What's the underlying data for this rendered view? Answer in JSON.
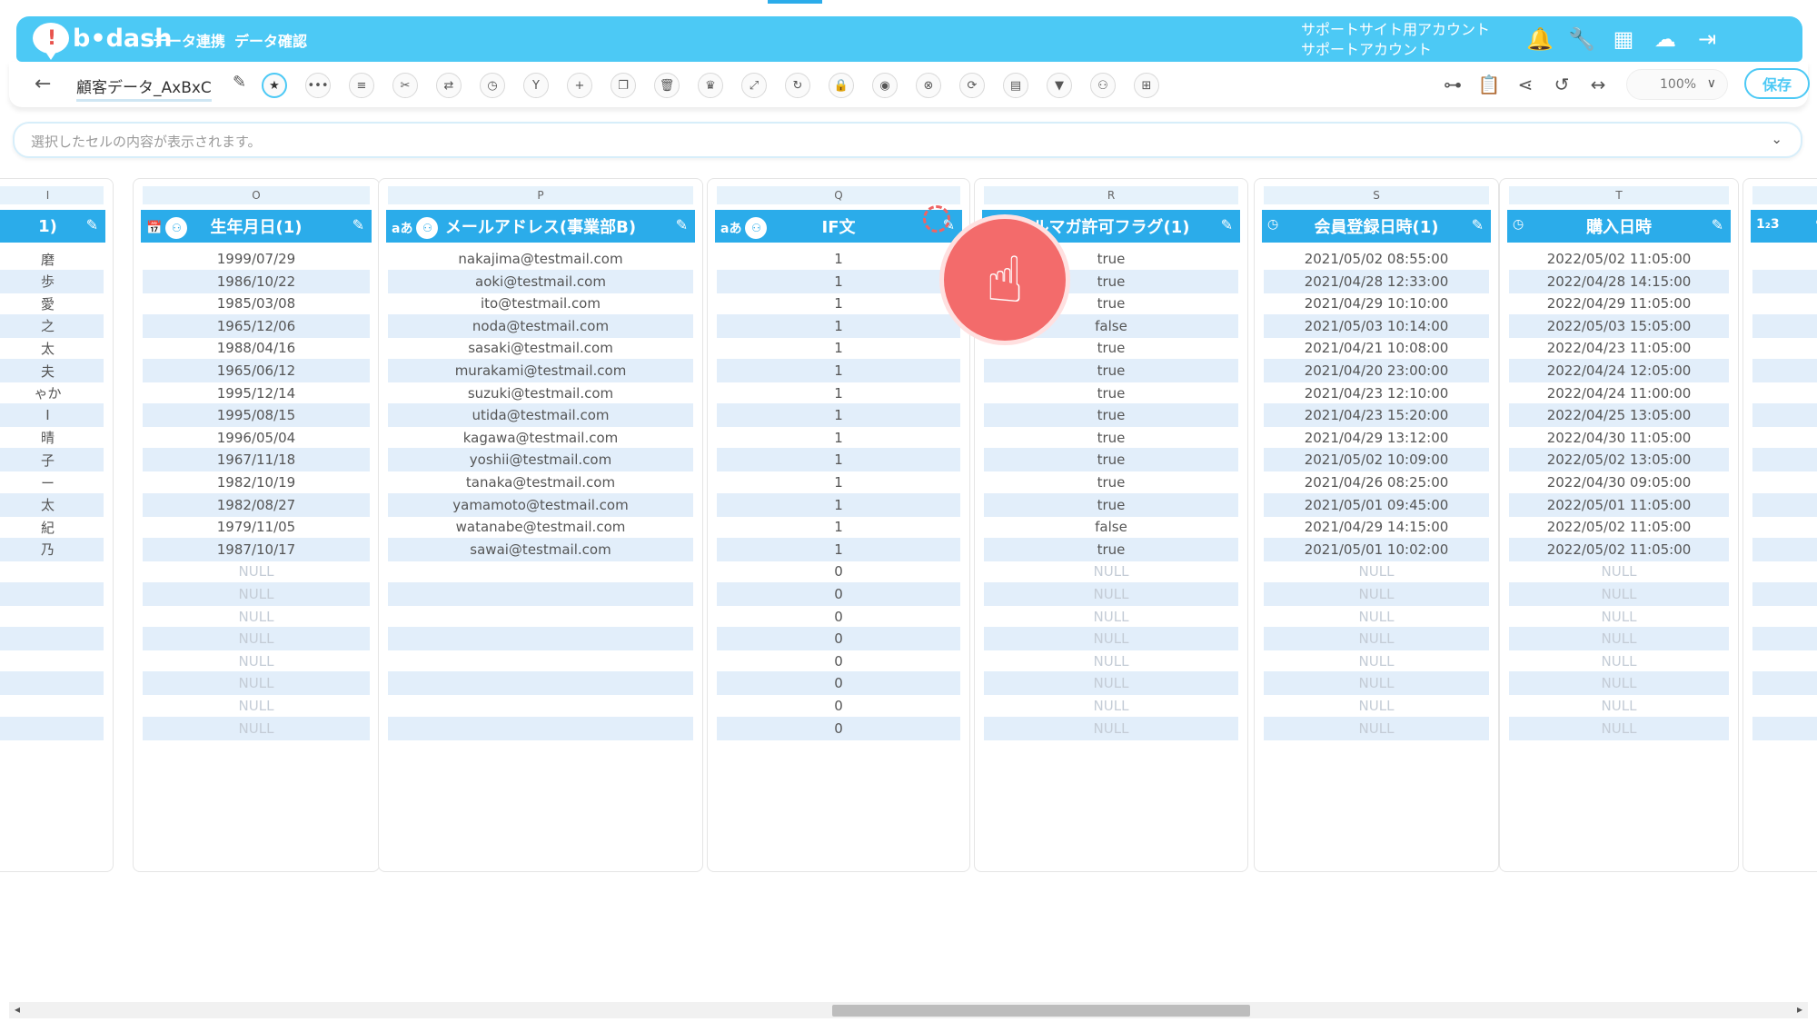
{
  "header": {
    "logo_text": "b•dash",
    "logo_mark": "!",
    "nav": [
      "データ連携",
      "データ確認"
    ],
    "account_line1": "サポートサイト用アカウント",
    "account_line2": "サポートアカウント"
  },
  "toolbar": {
    "tab_name": "顧客データ_AxBxC",
    "zoom": "100%",
    "save_label": "保存"
  },
  "cellbar": {
    "placeholder": "選択したセルの内容が表示されます。"
  },
  "columns": [
    {
      "letter": "I",
      "title": "1)",
      "cells": [
        "磨",
        "歩",
        "愛",
        "之",
        "太",
        "夫",
        "ゃか",
        "Ι",
        "晴",
        "子",
        "ー",
        "太",
        "紀",
        "乃",
        "",
        "",
        "",
        "",
        "",
        "",
        "",
        ""
      ]
    },
    {
      "letter": "O",
      "title": "生年月日(1)",
      "cells": [
        "1999/07/29",
        "1986/10/22",
        "1985/03/08",
        "1965/12/06",
        "1988/04/16",
        "1965/06/12",
        "1995/12/14",
        "1995/08/15",
        "1996/05/04",
        "1967/11/18",
        "1982/10/19",
        "1982/08/27",
        "1979/11/05",
        "1987/10/17",
        "NULL",
        "NULL",
        "NULL",
        "NULL",
        "NULL",
        "NULL",
        "NULL",
        "NULL"
      ]
    },
    {
      "letter": "P",
      "title": "メールアドレス(事業部B)",
      "cells": [
        "nakajima@testmail.com",
        "aoki@testmail.com",
        "ito@testmail.com",
        "noda@testmail.com",
        "sasaki@testmail.com",
        "murakami@testmail.com",
        "suzuki@testmail.com",
        "utida@testmail.com",
        "kagawa@testmail.com",
        "yoshii@testmail.com",
        "tanaka@testmail.com",
        "yamamoto@testmail.com",
        "watanabe@testmail.com",
        "sawai@testmail.com",
        "",
        "",
        "",
        "",
        "",
        "",
        "",
        ""
      ]
    },
    {
      "letter": "Q",
      "title": "IF文",
      "cells": [
        "1",
        "1",
        "1",
        "1",
        "1",
        "1",
        "1",
        "1",
        "1",
        "1",
        "1",
        "1",
        "1",
        "1",
        "0",
        "0",
        "0",
        "0",
        "0",
        "0",
        "0",
        "0"
      ]
    },
    {
      "letter": "R",
      "title": "ルマガ許可フラグ(1)",
      "cells": [
        "true",
        "true",
        "true",
        "false",
        "true",
        "true",
        "true",
        "true",
        "true",
        "true",
        "true",
        "true",
        "false",
        "true",
        "NULL",
        "NULL",
        "NULL",
        "NULL",
        "NULL",
        "NULL",
        "NULL",
        "NULL"
      ]
    },
    {
      "letter": "S",
      "title": "会員登録日時(1)",
      "cells": [
        "2021/05/02 08:55:00",
        "2021/04/28 12:33:00",
        "2021/04/29 10:10:00",
        "2021/05/03 10:14:00",
        "2021/04/21 10:08:00",
        "2021/04/20 23:00:00",
        "2021/04/23 12:10:00",
        "2021/04/23 15:20:00",
        "2021/04/29 13:12:00",
        "2021/05/02 10:09:00",
        "2021/04/26 08:25:00",
        "2021/05/01 09:45:00",
        "2021/04/29 14:15:00",
        "2021/05/01 10:02:00",
        "NULL",
        "NULL",
        "NULL",
        "NULL",
        "NULL",
        "NULL",
        "NULL",
        "NULL"
      ]
    },
    {
      "letter": "T",
      "title": "購入日時",
      "cells": [
        "2022/05/02 11:05:00",
        "2022/04/28 14:15:00",
        "2022/04/29 11:05:00",
        "2022/05/03 15:05:00",
        "2022/04/23 11:05:00",
        "2022/04/24 12:05:00",
        "2022/04/24 11:00:00",
        "2022/04/25 13:05:00",
        "2022/04/30 11:05:00",
        "2022/05/02 13:05:00",
        "2022/04/30 09:05:00",
        "2022/05/01 11:05:00",
        "2022/05/02 11:05:00",
        "2022/05/02 11:05:00",
        "NULL",
        "NULL",
        "NULL",
        "NULL",
        "NULL",
        "NULL",
        "NULL",
        "NULL"
      ]
    },
    {
      "letter": "",
      "title": "",
      "cells": [
        "",
        "",
        "",
        "",
        "",
        "",
        "",
        "",
        "",
        "",
        "",
        "",
        "",
        "",
        "",
        "",
        "",
        "",
        "",
        "",
        "",
        ""
      ]
    }
  ],
  "type_icons": {
    "O": "calendar-icon",
    "P": "text-type-icon",
    "Q": "text-type-icon",
    "R": "",
    "S": "clock-icon",
    "T": "clock-icon",
    "U": "number-type-icon"
  },
  "type_labels": {
    "text": "aあ",
    "number": "1₂3"
  },
  "colors": {
    "brand": "#4cc9f5",
    "header": "#2bacea",
    "stripe": "#e2eefa",
    "cursor": "#f36b6b"
  }
}
